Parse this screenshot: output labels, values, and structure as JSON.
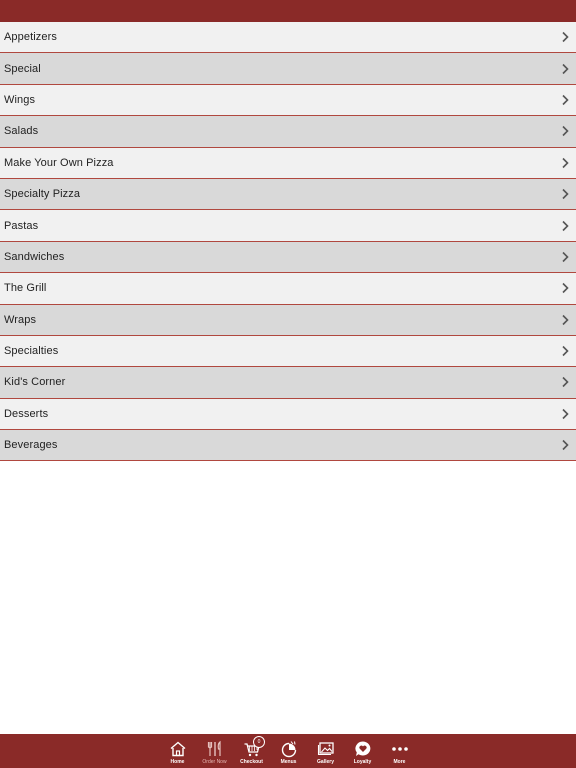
{
  "menu": {
    "items": [
      {
        "label": "Appetizers"
      },
      {
        "label": "Special"
      },
      {
        "label": "Wings"
      },
      {
        "label": "Salads"
      },
      {
        "label": "Make Your Own Pizza"
      },
      {
        "label": "Specialty Pizza"
      },
      {
        "label": "Pastas"
      },
      {
        "label": "Sandwiches"
      },
      {
        "label": "The Grill"
      },
      {
        "label": "Wraps"
      },
      {
        "label": "Specialties"
      },
      {
        "label": "Kid's Corner"
      },
      {
        "label": "Desserts"
      },
      {
        "label": "Beverages"
      }
    ]
  },
  "tabbar": {
    "tabs": [
      {
        "label": "Home",
        "icon": "home-icon"
      },
      {
        "label": "Order Now",
        "icon": "utensils-icon"
      },
      {
        "label": "Checkout",
        "icon": "cart-icon",
        "badge": "0"
      },
      {
        "label": "Menus",
        "icon": "menus-icon"
      },
      {
        "label": "Gallery",
        "icon": "gallery-icon"
      },
      {
        "label": "Loyalty",
        "icon": "heart-bubble-icon"
      },
      {
        "label": "More",
        "icon": "more-dots-icon"
      }
    ]
  },
  "colors": {
    "brand": "#8a2a28",
    "row_light": "#f1f1f1",
    "row_dark": "#d9d9d9"
  }
}
